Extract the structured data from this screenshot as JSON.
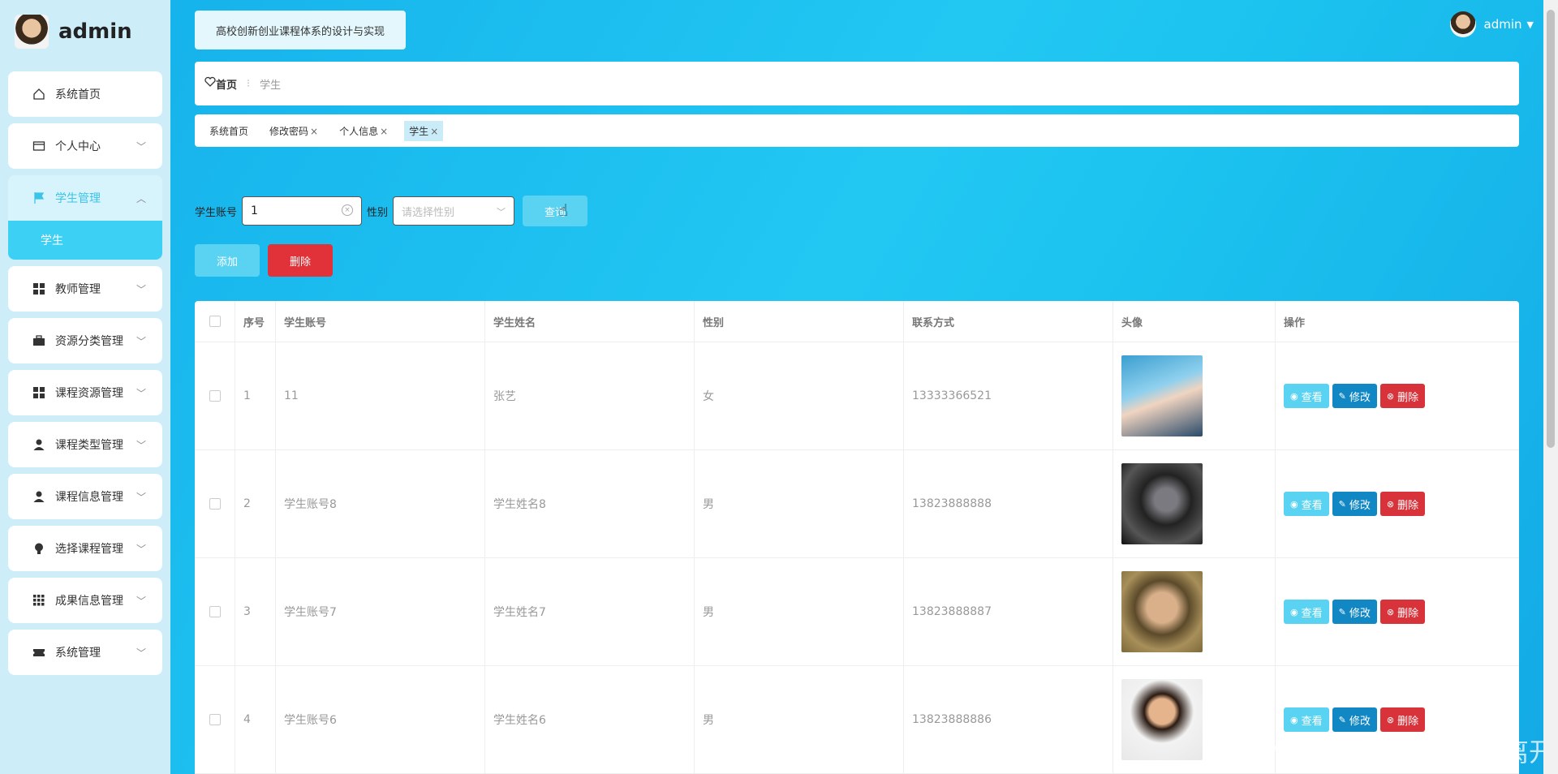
{
  "brand": {
    "name": "admin"
  },
  "sidebar": {
    "items": [
      {
        "label": "系统首页",
        "icon": "home-icon"
      },
      {
        "label": "个人中心",
        "icon": "id-card-icon"
      },
      {
        "label": "学生管理",
        "icon": "flag-icon",
        "sub": "学生"
      },
      {
        "label": "教师管理",
        "icon": "grid-icon"
      },
      {
        "label": "资源分类管理",
        "icon": "briefcase-icon"
      },
      {
        "label": "课程资源管理",
        "icon": "grid-icon"
      },
      {
        "label": "课程类型管理",
        "icon": "user-icon"
      },
      {
        "label": "课程信息管理",
        "icon": "user-icon"
      },
      {
        "label": "选择课程管理",
        "icon": "bulb-icon"
      },
      {
        "label": "成果信息管理",
        "icon": "apps-icon"
      },
      {
        "label": "系统管理",
        "icon": "ticket-icon"
      }
    ]
  },
  "header": {
    "site_title": "高校创新创业课程体系的设计与实现",
    "user": "admin"
  },
  "breadcrumb": {
    "home": "首页",
    "current": "学生"
  },
  "tags": [
    {
      "label": "系统首页"
    },
    {
      "label": "修改密码"
    },
    {
      "label": "个人信息"
    },
    {
      "label": "学生"
    }
  ],
  "search": {
    "account_label": "学生账号",
    "account_value": "1",
    "gender_label": "性别",
    "gender_placeholder": "请选择性别",
    "query_button": "查询"
  },
  "actions": {
    "add": "添加",
    "delete": "删除"
  },
  "table": {
    "headers": [
      "序号",
      "学生账号",
      "学生姓名",
      "性别",
      "联系方式",
      "头像",
      "操作"
    ],
    "rows": [
      {
        "no": "1",
        "account": "11",
        "name": "张艺",
        "gender": "女",
        "phone": "13333366521"
      },
      {
        "no": "2",
        "account": "学生账号8",
        "name": "学生姓名8",
        "gender": "男",
        "phone": "13823888888"
      },
      {
        "no": "3",
        "account": "学生账号7",
        "name": "学生姓名7",
        "gender": "男",
        "phone": "13823888887"
      },
      {
        "no": "4",
        "account": "学生账号6",
        "name": "学生姓名6",
        "gender": "男",
        "phone": "13823888886"
      }
    ],
    "row_ops": {
      "view": "查看",
      "edit": "修改",
      "remove": "删除"
    }
  },
  "watermark": "CSDN @不要满是遗憾的离开"
}
